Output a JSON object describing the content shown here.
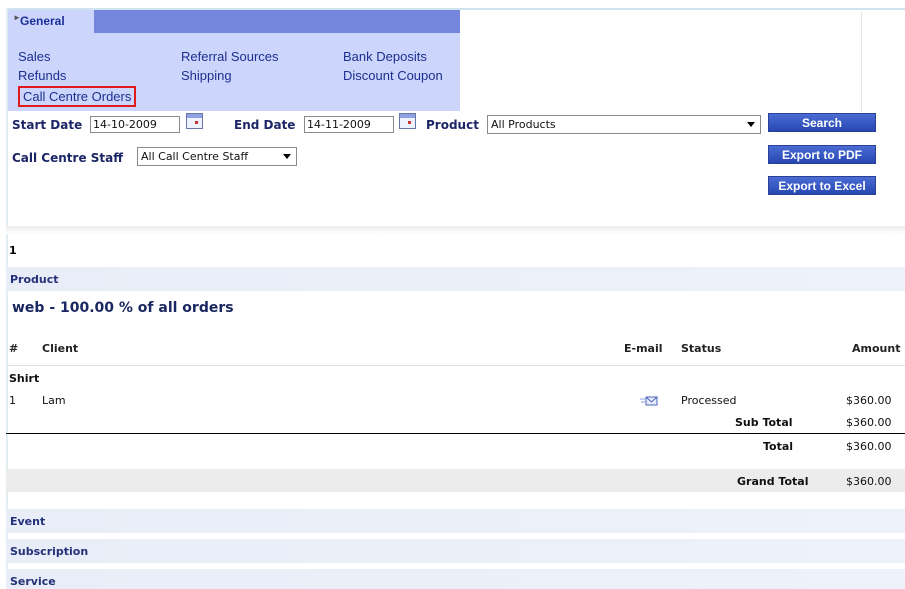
{
  "tabs": {
    "general": "General"
  },
  "menu": {
    "sales": "Sales",
    "refunds": "Refunds",
    "call_centre_orders": "Call Centre Orders",
    "referral_sources": "Referral Sources",
    "shipping": "Shipping",
    "bank_deposits": "Bank Deposits",
    "discount_coupon": "Discount Coupon"
  },
  "filters": {
    "start_date_label": "Start Date",
    "start_date_value": "14-10-2009",
    "end_date_label": "End Date",
    "end_date_value": "14-11-2009",
    "product_label": "Product",
    "product_value": "All Products",
    "staff_label": "Call Centre Staff",
    "staff_value": "All Call Centre Staff"
  },
  "buttons": {
    "search": "Search",
    "export_pdf": "Export to PDF",
    "export_excel": "Export to Excel"
  },
  "report": {
    "page_number": "1",
    "sections": {
      "product": "Product",
      "event": "Event",
      "subscription": "Subscription",
      "service": "Service"
    },
    "group_title": "web - 100.00 % of all orders",
    "columns": {
      "num": "#",
      "client": "Client",
      "email": "E-mail",
      "status": "Status",
      "amount": "Amount"
    },
    "category": "Shirt",
    "rows": [
      {
        "num": "1",
        "client": "Lam",
        "status": "Processed",
        "amount": "$360.00"
      }
    ],
    "subtotal_label": "Sub Total",
    "subtotal_value": "$360.00",
    "total_label": "Total",
    "total_value": "$360.00",
    "grand_total_label": "Grand Total",
    "grand_total_value": "$360.00"
  },
  "icons": {
    "calendar": "calendar-icon",
    "email": "email-icon",
    "dropdown": "chevron-down-icon"
  },
  "colors": {
    "accent": "#7487dc",
    "menu_bg": "#ccd5fb",
    "button": "#2f50bd",
    "active_outline": "#e11b1b"
  }
}
